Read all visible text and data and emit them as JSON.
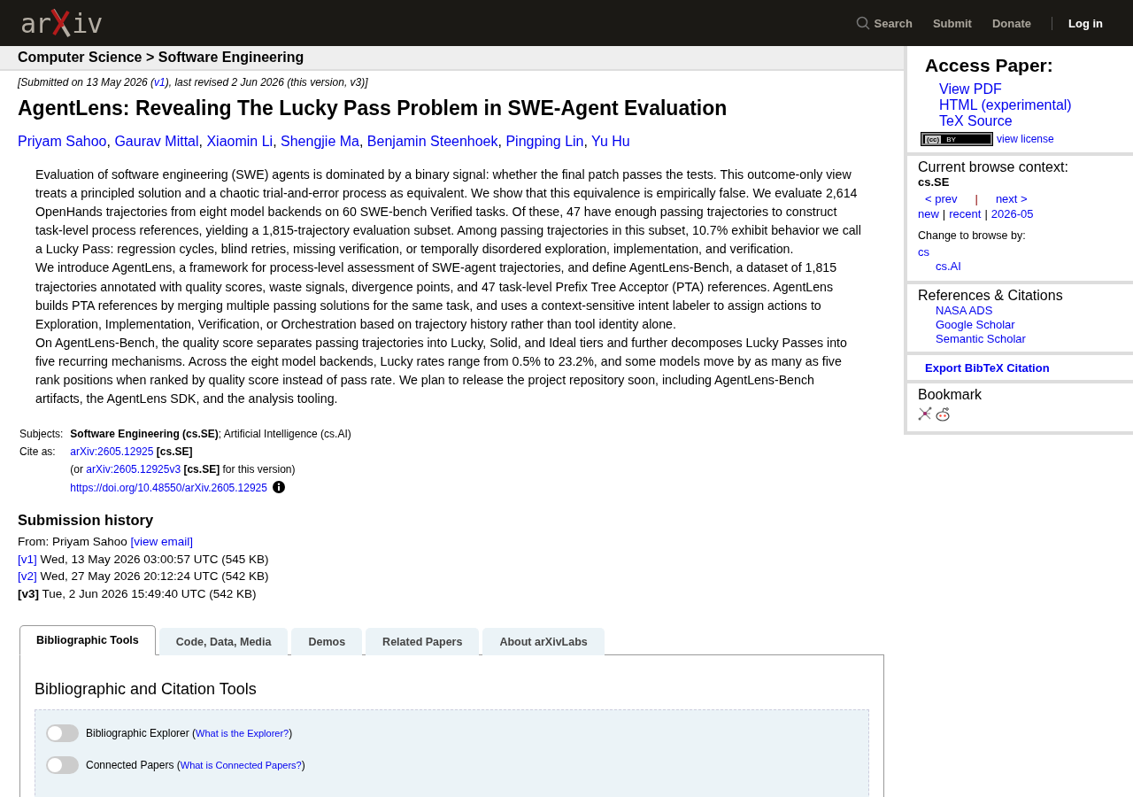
{
  "header": {
    "logo": {
      "left": "ar",
      "right": "iv"
    },
    "nav": [
      {
        "label": "Search",
        "kind": "search"
      },
      {
        "label": "Submit",
        "kind": "link"
      },
      {
        "label": "Donate",
        "kind": "link"
      },
      {
        "label": "Log in",
        "kind": "login"
      }
    ]
  },
  "breadcrumb": "Computer Science > Software Engineering",
  "submitted": {
    "before": "[Submitted on 13 May 2026 (",
    "link": "v1",
    "after": "), last revised 2 Jun 2026 (this version, v3)]"
  },
  "title": "AgentLens: Revealing The Lucky Pass Problem in SWE-Agent Evaluation",
  "author_separator": ", ",
  "authors": [
    "Priyam Sahoo",
    "Gaurav Mittal",
    "Xiaomin Li",
    "Shengjie Ma",
    "Benjamin Steenhoek",
    "Pingping Lin",
    "Yu Hu"
  ],
  "abstract": [
    "Evaluation of software engineering (SWE) agents is dominated by a binary signal: whether the final patch passes the tests. This outcome-only view treats a principled solution and a chaotic trial-and-error process as equivalent. We show that this equivalence is empirically false. We evaluate 2,614 OpenHands trajectories from eight model backends on 60 SWE-bench Verified tasks. Of these, 47 have enough passing trajectories to construct task-level process references, yielding a 1,815-trajectory evaluation subset. Among passing trajectories in this subset, 10.7% exhibit behavior we call a Lucky Pass: regression cycles, blind retries, missing verification, or temporally disordered exploration, implementation, and verification.",
    "We introduce AgentLens, a framework for process-level assessment of SWE-agent trajectories, and define AgentLens-Bench, a dataset of 1,815 trajectories annotated with quality scores, waste signals, divergence points, and 47 task-level Prefix Tree Acceptor (PTA) references. AgentLens builds PTA references by merging multiple passing solutions for the same task, and uses a context-sensitive intent labeler to assign actions to Exploration, Implementation, Verification, or Orchestration based on trajectory history rather than tool identity alone.",
    "On AgentLens-Bench, the quality score separates passing trajectories into Lucky, Solid, and Ideal tiers and further decomposes Lucky Passes into five recurring mechanisms. Across the eight model backends, Lucky rates range from 0.5% to 23.2%, and some models move by as many as five rank positions when ranked by quality score instead of pass rate. We plan to release the project repository soon, including AgentLens-Bench artifacts, the AgentLens SDK, and the analysis tooling."
  ],
  "metadata": {
    "subjects_label": "Subjects:",
    "subjects": "**Software Engineering (cs.SE)**; Artificial Intelligence (cs.AI)",
    "cite_label": "Cite as:",
    "cite_link": "arXiv:2605.12925",
    "cite_suffix": "[cs.SE]",
    "version_prefix": "(or ",
    "version_link": "arXiv:2605.12925v3",
    "version_suffix": " **[cs.SE]** for this version)",
    "doi": "https://doi.org/10.48550/arXiv.2605.12925"
  },
  "submission_history": {
    "heading": "Submission history",
    "from": "From: Priyam Sahoo ",
    "email_link": "[view email]",
    "versions": [
      {
        "label": "[v1]",
        "text": " Wed, 13 May 2026 03:00:57 UTC (545 KB)",
        "current": false
      },
      {
        "label": "[v2]",
        "text": " Wed, 27 May 2026 20:12:24 UTC (542 KB)",
        "current": false
      },
      {
        "label": "[v3]",
        "text": " Tue, 2 Jun 2026 15:49:40 UTC (542 KB)",
        "current": true
      }
    ]
  },
  "tabs": [
    {
      "label": "Bibliographic Tools",
      "selected": true
    },
    {
      "label": "Code, Data, Media",
      "selected": false
    },
    {
      "label": "Demos",
      "selected": false
    },
    {
      "label": "Related Papers",
      "selected": false
    },
    {
      "label": "About arXivLabs",
      "selected": false
    }
  ],
  "tools": {
    "heading": "Bibliographic and Citation Tools",
    "items": [
      {
        "label": "Bibliographic Explorer",
        "open": " (",
        "link": "What is the Explorer?",
        "close": ")",
        "on": false
      },
      {
        "label": "Connected Papers",
        "open": " (",
        "link": "What is Connected Papers?",
        "close": ")",
        "on": false
      }
    ]
  },
  "sidebar": {
    "access": {
      "heading": "Access Paper:",
      "links": [
        "View PDF",
        "HTML (experimental)",
        "TeX Source"
      ],
      "license_badge": {
        "cc": "(cc)",
        "by": "BY"
      },
      "license_link": "view license"
    },
    "context": {
      "heading": "Current browse context:",
      "category": "cs.SE",
      "prev": "< prev",
      "separator": "|",
      "next": "next >",
      "lists": [
        "new",
        "recent",
        "2026-05"
      ],
      "change_label": "Change to browse by:",
      "browse": [
        {
          "label": "cs",
          "children": [
            {
              "label": "cs.AI"
            }
          ]
        }
      ]
    },
    "references": {
      "heading": "References & Citations",
      "links": [
        "NASA ADS",
        "Google Scholar",
        "Semantic Scholar"
      ]
    },
    "export": "Export BibTeX Citation",
    "bookmark": {
      "heading": "Bookmark"
    }
  }
}
